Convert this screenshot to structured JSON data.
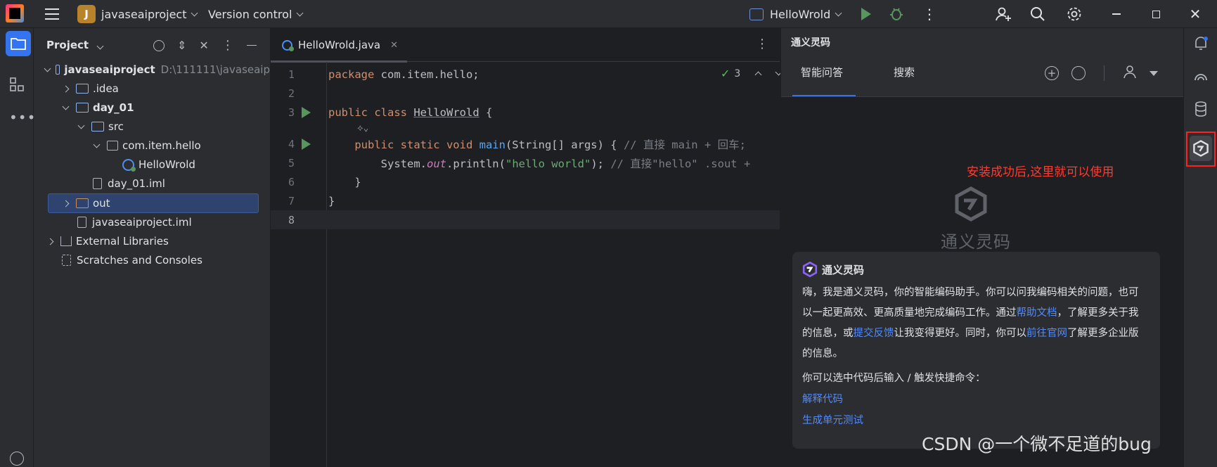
{
  "titlebar": {
    "project_badge": "J",
    "project_name": "javaseaiproject",
    "vcs": "Version control",
    "run_config": "HelloWrold"
  },
  "project_panel": {
    "title": "Project",
    "tree": [
      {
        "label": "javaseaiproject",
        "path": "D:\\111111\\javaseaip",
        "level": 0,
        "expanded": true,
        "bold": true,
        "icon": "module-folder"
      },
      {
        "label": ".idea",
        "level": 1,
        "expanded": false,
        "icon": "folder"
      },
      {
        "label": "day_01",
        "level": 1,
        "expanded": true,
        "bold": true,
        "icon": "module-folder"
      },
      {
        "label": "src",
        "level": 2,
        "expanded": true,
        "icon": "source-folder"
      },
      {
        "label": "com.item.hello",
        "level": 3,
        "expanded": true,
        "icon": "package"
      },
      {
        "label": "HelloWrold",
        "level": 4,
        "icon": "java-class"
      },
      {
        "label": "day_01.iml",
        "level": 3,
        "icon": "iml-file"
      },
      {
        "label": "out",
        "level": 1,
        "expanded": false,
        "selected": true,
        "icon": "excluded-folder"
      },
      {
        "label": "javaseaiproject.iml",
        "level": 1,
        "icon": "iml-file"
      },
      {
        "label": "External Libraries",
        "level": 0,
        "expanded": false,
        "icon": "library"
      },
      {
        "label": "Scratches and Consoles",
        "level": 0,
        "icon": "scratches"
      }
    ]
  },
  "editor": {
    "tab_label": "HelloWrold.java",
    "inspection_count": "3",
    "line_numbers": [
      "1",
      "2",
      "3",
      "4",
      "5",
      "6",
      "7",
      "8"
    ],
    "code": {
      "l1_kw": "package",
      "l1_rest": " com.item.hello;",
      "l3_kw": "public class ",
      "l3_name": "HelloWrold",
      "l3_rest": " {",
      "l4_kw": "public static void ",
      "l4_fn": "main",
      "l4_rest": "(String[] args) { ",
      "l4_cm": "// 直接 main + 回车;",
      "l5_a": "System.",
      "l5_out": "out",
      "l5_b": ".println(",
      "l5_str": "\"hello world\"",
      "l5_c": "); ",
      "l5_cm": "// 直接\"hello\" .sout +",
      "l6": "}",
      "l7": "}"
    }
  },
  "tongyi": {
    "title": "通义灵码",
    "tabs": [
      "智能问答",
      "搜索"
    ],
    "annotation": "安装成功后,这里就可以使用",
    "logo_text": "通义灵码",
    "card": {
      "title": "通义灵码",
      "p1_a": "嗨，我是通义灵码，你的智能编码助手。你可以问我编码相关的问题，也可以一起更高效、更高质量地完成编码工作。通过",
      "p1_link1": "帮助文档",
      "p1_b": "，了解更多关于我的信息，或",
      "p1_link2": "提交反馈",
      "p1_c": "让我变得更好。同时，你可以",
      "p1_link3": "前往官网",
      "p1_d": "了解更多企业版的信息。",
      "p2": "你可以选中代码后输入 / 触发快捷命令：",
      "cmd1": "解释代码",
      "cmd2": "生成单元测试"
    }
  },
  "watermark": "CSDN @一个微不足道的bug",
  "colors": {
    "accent": "#3574f0",
    "annotation_red": "#ff3b30",
    "run_green": "#57965c"
  }
}
